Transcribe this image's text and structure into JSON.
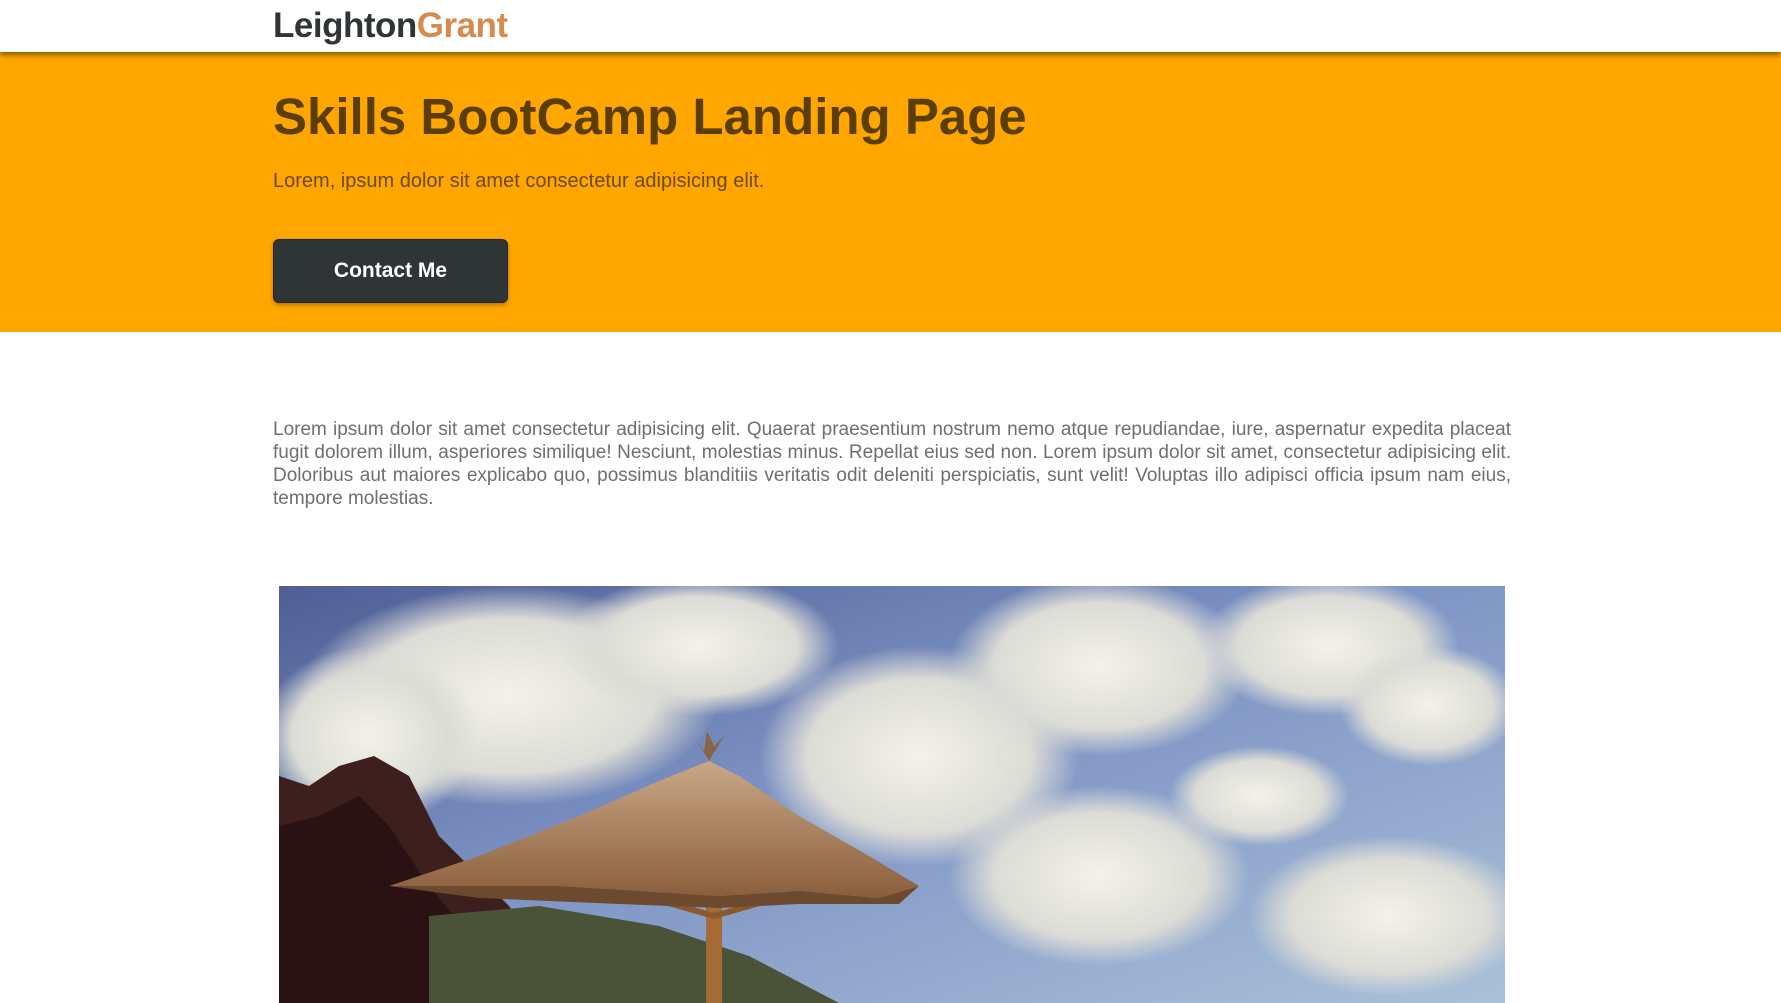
{
  "navbar": {
    "brand_first": "Leighton",
    "brand_last": "Grant"
  },
  "hero": {
    "title": "Skills BootCamp Landing Page",
    "subtitle": "Lorem, ipsum dolor sit amet consectetur adipisicing elit.",
    "button_label": "Contact Me"
  },
  "intro": {
    "text": "Lorem ipsum dolor sit amet consectetur adipisicing elit. Quaerat praesentium nostrum nemo atque repudiandae, iure, aspernatur expedita placeat fugit dolorem illum, asperiores similique! Nesciunt, molestias minus. Repellat eius sed non. Lorem ipsum dolor sit amet, consectetur adipisicing elit. Doloribus aut maiores explicabo quo, possimus blanditiis veritatis odit deleniti perspiciatis, sunt velit! Voluptas illo adipisci officia ipsum nam eius, tempore molestias."
  },
  "colors": {
    "hero_background": "#ffa601",
    "brand_accent": "#d9894c",
    "button_background": "#2f3436",
    "title_text": "#5b3d06"
  }
}
